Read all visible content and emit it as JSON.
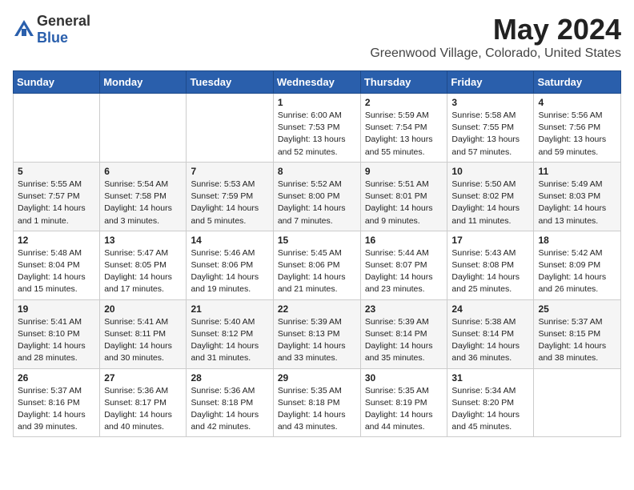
{
  "header": {
    "logo_general": "General",
    "logo_blue": "Blue",
    "month": "May 2024",
    "location": "Greenwood Village, Colorado, United States"
  },
  "weekdays": [
    "Sunday",
    "Monday",
    "Tuesday",
    "Wednesday",
    "Thursday",
    "Friday",
    "Saturday"
  ],
  "weeks": [
    [
      {
        "day": "",
        "sunrise": "",
        "sunset": "",
        "daylight": ""
      },
      {
        "day": "",
        "sunrise": "",
        "sunset": "",
        "daylight": ""
      },
      {
        "day": "",
        "sunrise": "",
        "sunset": "",
        "daylight": ""
      },
      {
        "day": "1",
        "sunrise": "Sunrise: 6:00 AM",
        "sunset": "Sunset: 7:53 PM",
        "daylight": "Daylight: 13 hours and 52 minutes."
      },
      {
        "day": "2",
        "sunrise": "Sunrise: 5:59 AM",
        "sunset": "Sunset: 7:54 PM",
        "daylight": "Daylight: 13 hours and 55 minutes."
      },
      {
        "day": "3",
        "sunrise": "Sunrise: 5:58 AM",
        "sunset": "Sunset: 7:55 PM",
        "daylight": "Daylight: 13 hours and 57 minutes."
      },
      {
        "day": "4",
        "sunrise": "Sunrise: 5:56 AM",
        "sunset": "Sunset: 7:56 PM",
        "daylight": "Daylight: 13 hours and 59 minutes."
      }
    ],
    [
      {
        "day": "5",
        "sunrise": "Sunrise: 5:55 AM",
        "sunset": "Sunset: 7:57 PM",
        "daylight": "Daylight: 14 hours and 1 minute."
      },
      {
        "day": "6",
        "sunrise": "Sunrise: 5:54 AM",
        "sunset": "Sunset: 7:58 PM",
        "daylight": "Daylight: 14 hours and 3 minutes."
      },
      {
        "day": "7",
        "sunrise": "Sunrise: 5:53 AM",
        "sunset": "Sunset: 7:59 PM",
        "daylight": "Daylight: 14 hours and 5 minutes."
      },
      {
        "day": "8",
        "sunrise": "Sunrise: 5:52 AM",
        "sunset": "Sunset: 8:00 PM",
        "daylight": "Daylight: 14 hours and 7 minutes."
      },
      {
        "day": "9",
        "sunrise": "Sunrise: 5:51 AM",
        "sunset": "Sunset: 8:01 PM",
        "daylight": "Daylight: 14 hours and 9 minutes."
      },
      {
        "day": "10",
        "sunrise": "Sunrise: 5:50 AM",
        "sunset": "Sunset: 8:02 PM",
        "daylight": "Daylight: 14 hours and 11 minutes."
      },
      {
        "day": "11",
        "sunrise": "Sunrise: 5:49 AM",
        "sunset": "Sunset: 8:03 PM",
        "daylight": "Daylight: 14 hours and 13 minutes."
      }
    ],
    [
      {
        "day": "12",
        "sunrise": "Sunrise: 5:48 AM",
        "sunset": "Sunset: 8:04 PM",
        "daylight": "Daylight: 14 hours and 15 minutes."
      },
      {
        "day": "13",
        "sunrise": "Sunrise: 5:47 AM",
        "sunset": "Sunset: 8:05 PM",
        "daylight": "Daylight: 14 hours and 17 minutes."
      },
      {
        "day": "14",
        "sunrise": "Sunrise: 5:46 AM",
        "sunset": "Sunset: 8:06 PM",
        "daylight": "Daylight: 14 hours and 19 minutes."
      },
      {
        "day": "15",
        "sunrise": "Sunrise: 5:45 AM",
        "sunset": "Sunset: 8:06 PM",
        "daylight": "Daylight: 14 hours and 21 minutes."
      },
      {
        "day": "16",
        "sunrise": "Sunrise: 5:44 AM",
        "sunset": "Sunset: 8:07 PM",
        "daylight": "Daylight: 14 hours and 23 minutes."
      },
      {
        "day": "17",
        "sunrise": "Sunrise: 5:43 AM",
        "sunset": "Sunset: 8:08 PM",
        "daylight": "Daylight: 14 hours and 25 minutes."
      },
      {
        "day": "18",
        "sunrise": "Sunrise: 5:42 AM",
        "sunset": "Sunset: 8:09 PM",
        "daylight": "Daylight: 14 hours and 26 minutes."
      }
    ],
    [
      {
        "day": "19",
        "sunrise": "Sunrise: 5:41 AM",
        "sunset": "Sunset: 8:10 PM",
        "daylight": "Daylight: 14 hours and 28 minutes."
      },
      {
        "day": "20",
        "sunrise": "Sunrise: 5:41 AM",
        "sunset": "Sunset: 8:11 PM",
        "daylight": "Daylight: 14 hours and 30 minutes."
      },
      {
        "day": "21",
        "sunrise": "Sunrise: 5:40 AM",
        "sunset": "Sunset: 8:12 PM",
        "daylight": "Daylight: 14 hours and 31 minutes."
      },
      {
        "day": "22",
        "sunrise": "Sunrise: 5:39 AM",
        "sunset": "Sunset: 8:13 PM",
        "daylight": "Daylight: 14 hours and 33 minutes."
      },
      {
        "day": "23",
        "sunrise": "Sunrise: 5:39 AM",
        "sunset": "Sunset: 8:14 PM",
        "daylight": "Daylight: 14 hours and 35 minutes."
      },
      {
        "day": "24",
        "sunrise": "Sunrise: 5:38 AM",
        "sunset": "Sunset: 8:14 PM",
        "daylight": "Daylight: 14 hours and 36 minutes."
      },
      {
        "day": "25",
        "sunrise": "Sunrise: 5:37 AM",
        "sunset": "Sunset: 8:15 PM",
        "daylight": "Daylight: 14 hours and 38 minutes."
      }
    ],
    [
      {
        "day": "26",
        "sunrise": "Sunrise: 5:37 AM",
        "sunset": "Sunset: 8:16 PM",
        "daylight": "Daylight: 14 hours and 39 minutes."
      },
      {
        "day": "27",
        "sunrise": "Sunrise: 5:36 AM",
        "sunset": "Sunset: 8:17 PM",
        "daylight": "Daylight: 14 hours and 40 minutes."
      },
      {
        "day": "28",
        "sunrise": "Sunrise: 5:36 AM",
        "sunset": "Sunset: 8:18 PM",
        "daylight": "Daylight: 14 hours and 42 minutes."
      },
      {
        "day": "29",
        "sunrise": "Sunrise: 5:35 AM",
        "sunset": "Sunset: 8:18 PM",
        "daylight": "Daylight: 14 hours and 43 minutes."
      },
      {
        "day": "30",
        "sunrise": "Sunrise: 5:35 AM",
        "sunset": "Sunset: 8:19 PM",
        "daylight": "Daylight: 14 hours and 44 minutes."
      },
      {
        "day": "31",
        "sunrise": "Sunrise: 5:34 AM",
        "sunset": "Sunset: 8:20 PM",
        "daylight": "Daylight: 14 hours and 45 minutes."
      },
      {
        "day": "",
        "sunrise": "",
        "sunset": "",
        "daylight": ""
      }
    ]
  ]
}
